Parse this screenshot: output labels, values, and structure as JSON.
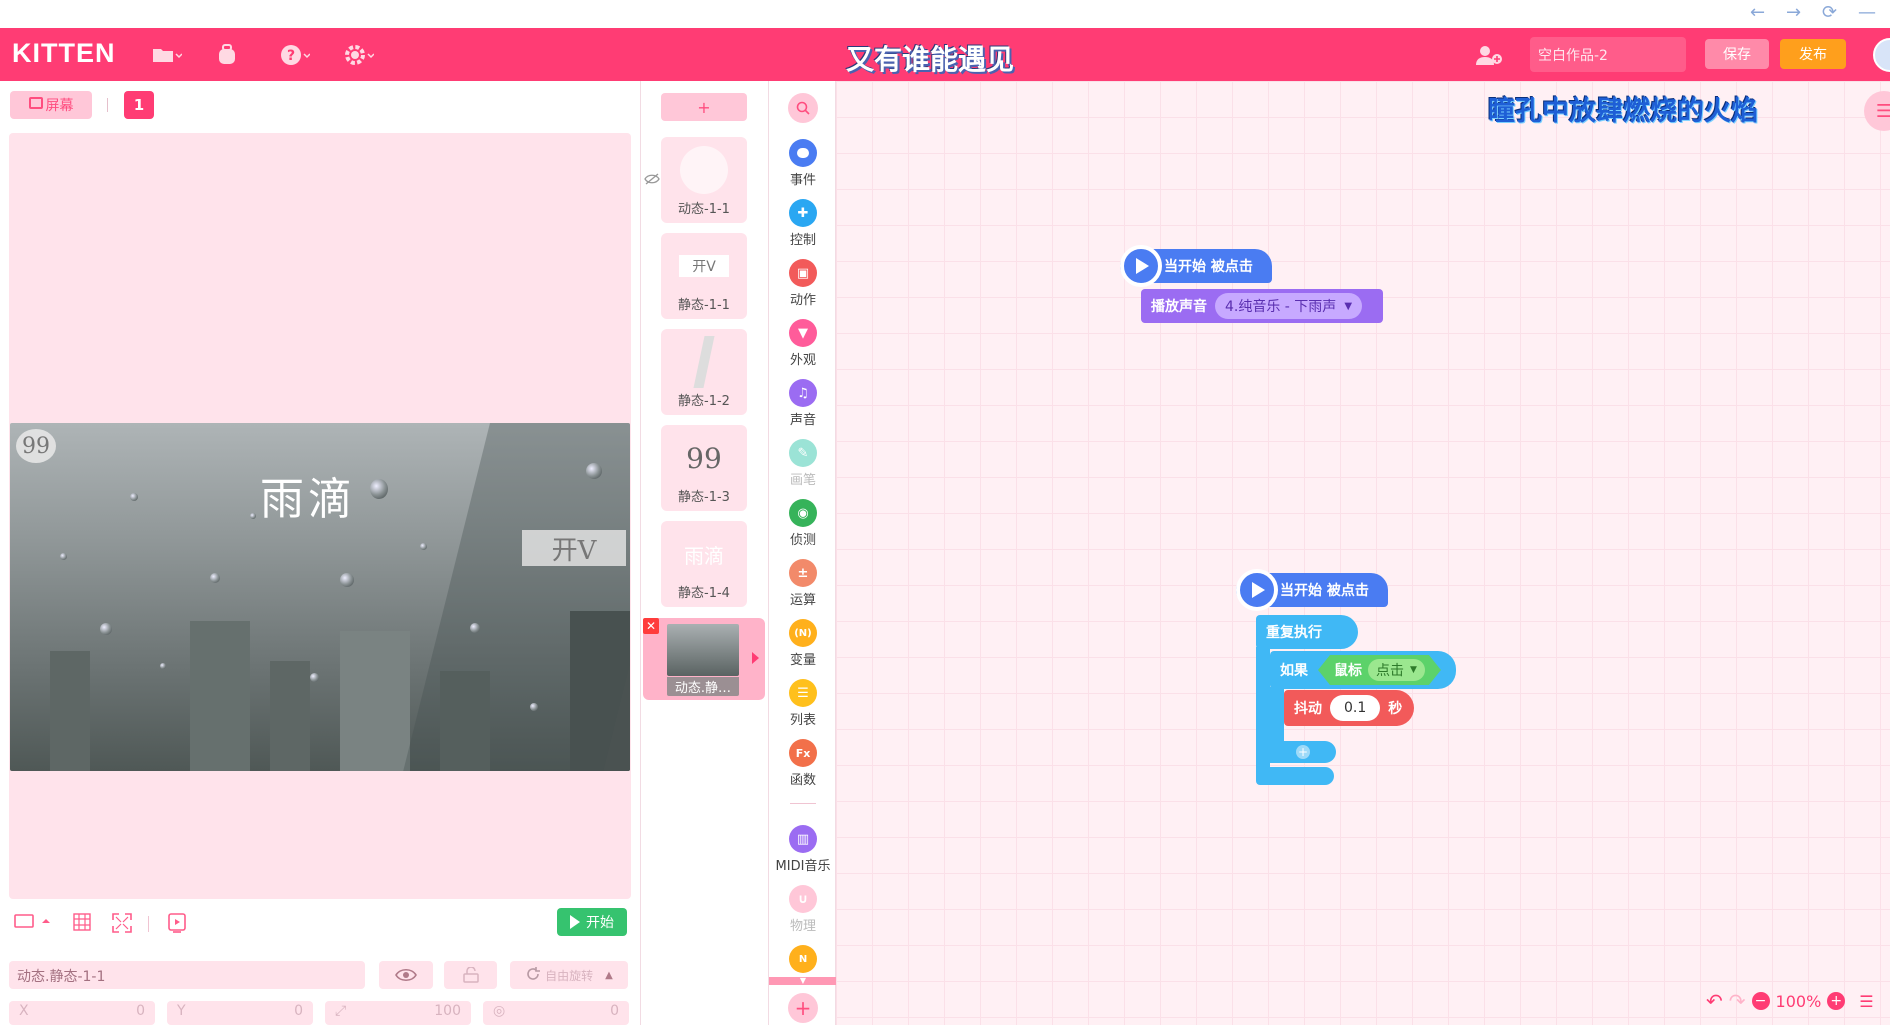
{
  "header": {
    "logo": "KITTEN",
    "title": "又有谁能遇见",
    "project_name": "空白作品-2",
    "save_label": "保存",
    "publish_label": "发布"
  },
  "stage": {
    "screen_label": "屏幕",
    "screen_number": "1",
    "image_text": "雨滴",
    "badge_open": "开V",
    "badge_quote": "99",
    "start_label": "开始"
  },
  "sprite_props": {
    "name": "动态.静态-1-1",
    "rotate_label": "自由旋转",
    "x_label": "X",
    "x_value": "0",
    "y_label": "Y",
    "y_value": "0",
    "size_value": "100",
    "dir_value": "0"
  },
  "sprites": {
    "add_label": "+",
    "items": [
      {
        "label": "动态-1-1"
      },
      {
        "label": "静态-1-1",
        "thumb": "开V"
      },
      {
        "label": "静态-1-2"
      },
      {
        "label": "静态-1-3",
        "thumb": "99"
      },
      {
        "label": "静态-1-4",
        "thumb": "雨滴"
      },
      {
        "label": "动态.静…"
      }
    ]
  },
  "categories": [
    {
      "label": "事件",
      "color": "#4a7cf2"
    },
    {
      "label": "控制",
      "color": "#2aa7f2"
    },
    {
      "label": "动作",
      "color": "#f25a5a"
    },
    {
      "label": "外观",
      "color": "#ff5c9a"
    },
    {
      "label": "声音",
      "color": "#9b6cf2"
    },
    {
      "label": "画笔",
      "color": "#9be3d6"
    },
    {
      "label": "侦测",
      "color": "#36b35a"
    },
    {
      "label": "运算",
      "color": "#f28a6a"
    },
    {
      "label": "变量",
      "color": "#ffb01c"
    },
    {
      "label": "列表",
      "color": "#ffc01c"
    },
    {
      "label": "函数",
      "color": "#f2704a"
    },
    {
      "label": "MIDI音乐",
      "color": "#9b6cf2"
    },
    {
      "label": "物理",
      "color": "#ffc7d8"
    }
  ],
  "workspace": {
    "caption": "瞳孔中放肆燃烧的火焰",
    "hat1": "当开始 被点击",
    "play_sound": "播放声音",
    "sound_name": "4.纯音乐 - 下雨声",
    "hat2": "当开始 被点击",
    "repeat": "重复执行",
    "if_label": "如果",
    "mouse_label": "鼠标",
    "click_label": "点击",
    "shake_label": "抖动",
    "shake_value": "0.1",
    "seconds_label": "秒",
    "zoom": "100%"
  }
}
